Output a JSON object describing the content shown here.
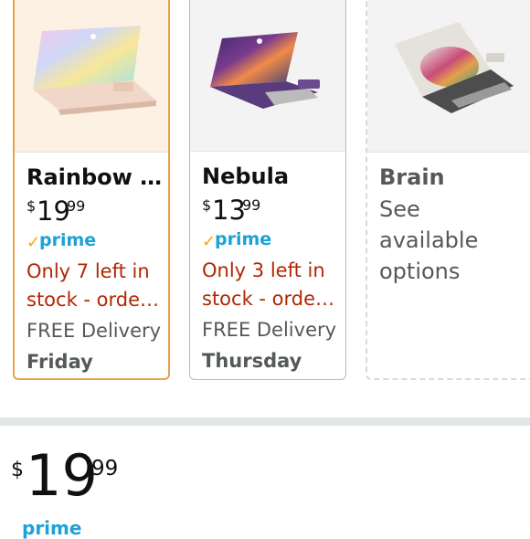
{
  "products": [
    {
      "title": "Rainbow …",
      "price": {
        "currency": "$",
        "whole": "19",
        "fraction": "99"
      },
      "prime": "prime",
      "stock": [
        "Only 7 left in",
        "stock - orde…"
      ],
      "delivery": "FREE Delivery",
      "delivery_day": "Friday",
      "state": "selected"
    },
    {
      "title": "Nebula",
      "price": {
        "currency": "$",
        "whole": "13",
        "fraction": "99"
      },
      "prime": "prime",
      "stock": [
        "Only 3 left in",
        "stock - orde…"
      ],
      "delivery": "FREE Delivery",
      "delivery_day": "Thursday",
      "state": "available"
    },
    {
      "title": "Brain",
      "options_text": [
        "See",
        "available",
        "options"
      ],
      "state": "unavailable"
    }
  ],
  "selected_price": {
    "currency": "$",
    "whole": "19",
    "fraction": "99"
  },
  "selected_prime": "prime",
  "colors": {
    "selected_border": "#e5a54a",
    "stock_red": "#b12704",
    "prime_blue": "#1da1d6",
    "prime_check": "#f7a500"
  }
}
